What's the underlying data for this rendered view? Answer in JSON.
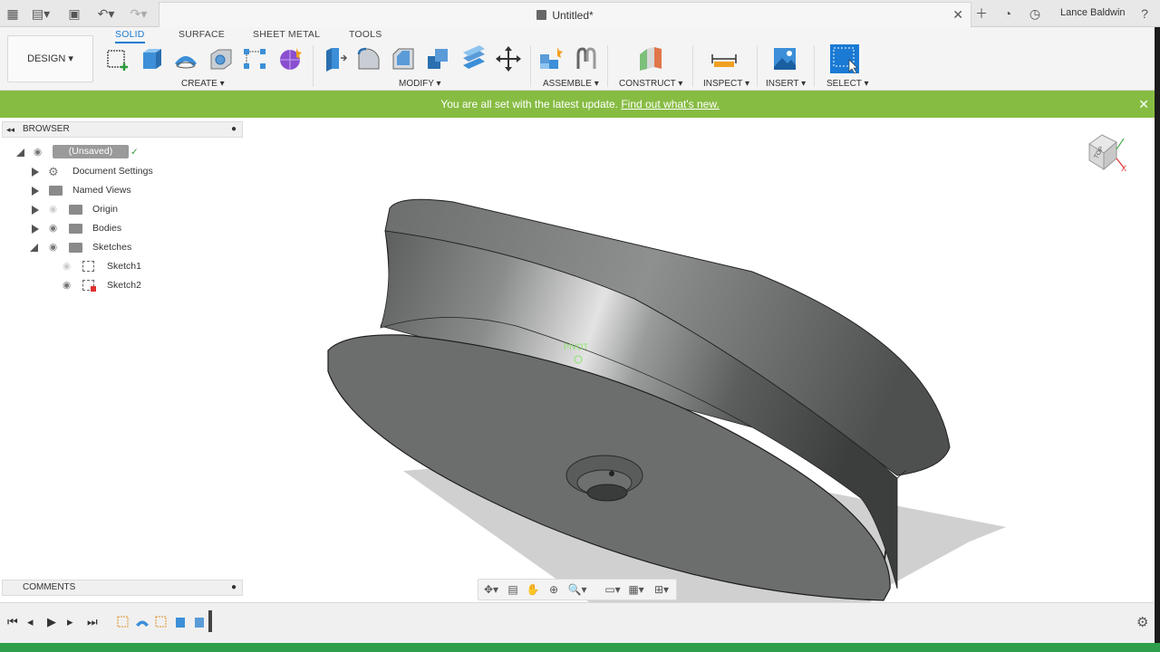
{
  "window": {
    "title": "Untitled*",
    "user": "Lance Baldwin"
  },
  "toolbar": {
    "workspace": "DESIGN",
    "tabs": [
      {
        "label": "SOLID",
        "active": true
      },
      {
        "label": "SURFACE",
        "active": false
      },
      {
        "label": "SHEET METAL",
        "active": false
      },
      {
        "label": "TOOLS",
        "active": false
      }
    ],
    "groups": {
      "create": "CREATE",
      "modify": "MODIFY",
      "assemble": "ASSEMBLE",
      "construct": "CONSTRUCT",
      "inspect": "INSPECT",
      "insert": "INSERT",
      "select": "SELECT"
    }
  },
  "banner": {
    "text": "You are all set with the latest update.",
    "link": "Find out what's new."
  },
  "browser": {
    "title": "BROWSER",
    "root": "(Unsaved)",
    "items": [
      {
        "label": "Document Settings"
      },
      {
        "label": "Named Views"
      },
      {
        "label": "Origin"
      },
      {
        "label": "Bodies"
      },
      {
        "label": "Sketches"
      },
      {
        "label": "Sketch1"
      },
      {
        "label": "Sketch2"
      }
    ]
  },
  "comments": {
    "title": "COMMENTS"
  },
  "viewport": {
    "pivot_label": "PIVOT",
    "viewcube_face": "TOP",
    "axis_x": "X"
  },
  "colors": {
    "accent": "#1a7ad4",
    "banner": "#87bc43",
    "model": "#6b6d6c"
  }
}
